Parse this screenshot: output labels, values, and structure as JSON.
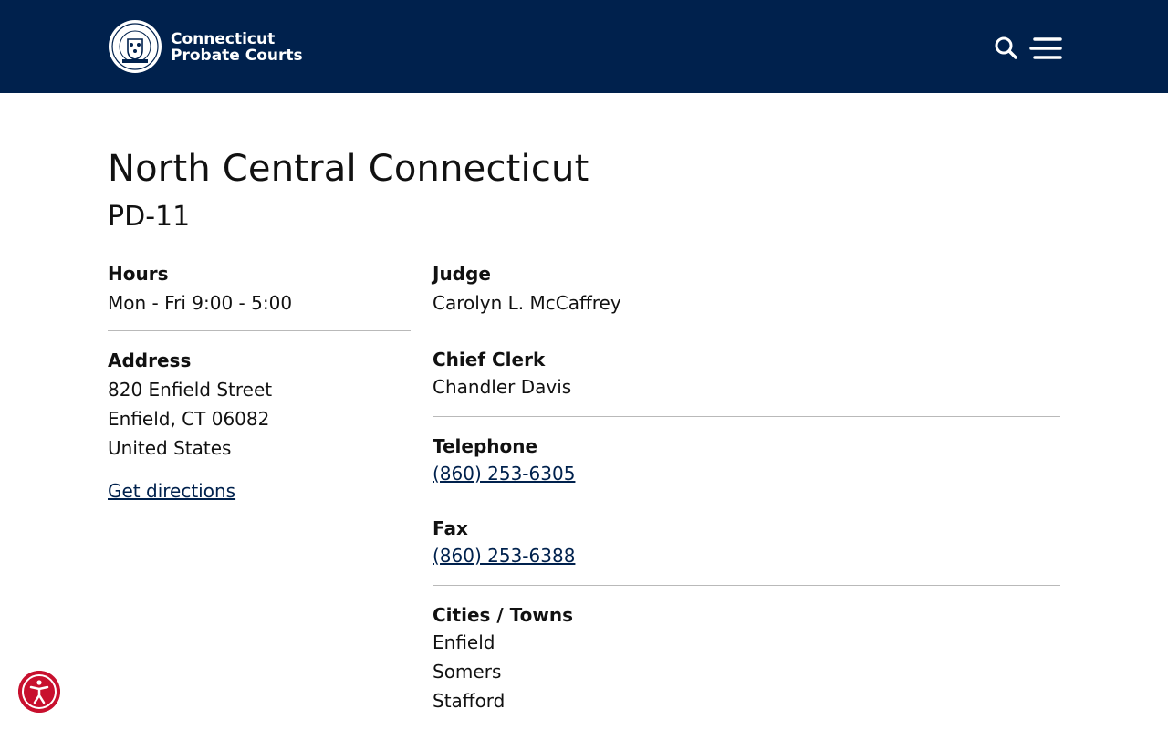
{
  "header": {
    "brand_line1": "Connecticut",
    "brand_line2": "Probate Courts",
    "logo_icon": "connecticut-seal-logo",
    "search_icon": "search-icon",
    "menu_icon": "hamburger-menu-icon",
    "bg_color": "#00214d"
  },
  "page": {
    "title": "North Central Connecticut",
    "subtitle": "PD-11"
  },
  "left": {
    "hours_label": "Hours",
    "hours_value": "Mon - Fri 9:00 - 5:00",
    "address_label": "Address",
    "address_line1": "820 Enfield Street",
    "address_line2": "Enfield, CT 06082",
    "address_line3": "United States",
    "directions_link": "Get directions"
  },
  "right": {
    "judge_label": "Judge",
    "judge_value": "Carolyn L. McCaffrey",
    "clerk_label": "Chief Clerk",
    "clerk_value": "Chandler Davis",
    "telephone_label": "Telephone",
    "telephone_value": "(860) 253-6305",
    "fax_label": "Fax",
    "fax_value": "(860) 253-6388",
    "towns_label": "Cities / Towns",
    "towns": [
      "Enfield",
      "Somers",
      "Stafford"
    ]
  },
  "accessibility": {
    "icon": "accessibility-icon",
    "color": "#c8102e"
  }
}
